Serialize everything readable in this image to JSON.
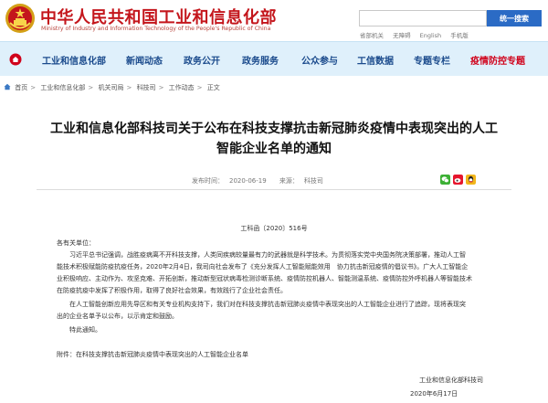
{
  "header": {
    "title_cn": "中华人民共和国工业和信息化部",
    "title_en": "Ministry of Industry and Information Technology of the People's Republic of China",
    "search_placeholder": "",
    "search_button": "统一搜索",
    "top_links": [
      "省部机关",
      "无障碍",
      "English",
      "手机版"
    ]
  },
  "nav": {
    "items": [
      {
        "label": "工业和信息化部"
      },
      {
        "label": "新闻动态"
      },
      {
        "label": "政务公开"
      },
      {
        "label": "政务服务"
      },
      {
        "label": "公众参与"
      },
      {
        "label": "工信数据"
      },
      {
        "label": "专题专栏"
      },
      {
        "label": "疫情防控专题"
      }
    ]
  },
  "breadcrumb": [
    "首页",
    "工业和信息化部",
    "机关司局",
    "科技司",
    "工作动态",
    "正文"
  ],
  "article": {
    "title_line1": "工业和信息化部科技司关于公布在科技支撑抗击新冠肺炎疫情中表现突出的人工",
    "title_line2": "智能企业名单的通知",
    "meta_date_label": "发布时间：",
    "meta_date": "2020-06-19",
    "meta_source_label": "来源：",
    "meta_source": "科技司",
    "doc_no": "工科函〔2020〕516号",
    "paragraphs": [
      "各有关单位：",
      "　　习近平总书记强调，战胜疫病离不开科技支撑，人类同疾病较量最有力的武器就是科学技术。为贯彻落实党中央国务院决策部署，推动人工智",
      "能技术积极赋能防疫抗疫任务，2020年2月4日，我司向社会发布了《充分发挥人工智能赋能效用　协力抗击新冠疫情的倡议书》。广大人工智能企",
      "业积极响应、主动作为、攻坚克难、开拓创新，推动新型冠状病毒检测诊断系统、疫情防控机器人、智能测温系统、疫情防控外呼机器人等智能技术",
      "在防疫抗疫中发挥了积极作用，取得了良好社会效果，有效践行了企业社会责任。",
      "　　在人工智能创新应用先导区和有关专业机构支持下，我们对在科技支撑抗击新冠肺炎疫情中表现突出的人工智能企业进行了追踪，现将表现突",
      "出的企业名单予以公布，以示肯定和鼓励。",
      "　　特此通知。"
    ],
    "attachment": "附件：在科技支撑抗击新冠肺炎疫情中表现突出的人工智能企业名单",
    "signature_org": "工业和信息化部科技司",
    "signature_date": "2020年6月17日"
  },
  "colors": {
    "brand_red": "#c4161c",
    "nav_blue": "#1a4a8c",
    "nav_bg": "#dff0fb",
    "search_blue": "#2b6bc5",
    "active_red": "#d0021b"
  },
  "icons": [
    "national-emblem-icon",
    "home-icon",
    "share-wechat-icon",
    "share-weibo-icon",
    "share-qq-icon"
  ]
}
